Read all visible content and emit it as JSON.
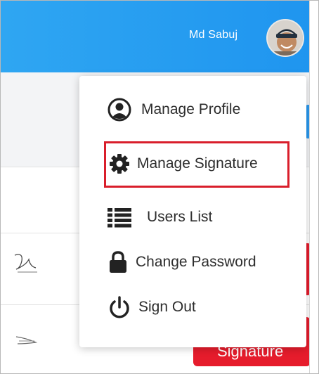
{
  "header": {
    "user_name": "Md Sabuj",
    "avatar_icon": "user-avatar-photo"
  },
  "menu": {
    "items": [
      {
        "label": "Manage Profile",
        "icon": "user-circle-icon"
      },
      {
        "label": "Manage Signature",
        "icon": "gear-icon",
        "highlighted": true
      },
      {
        "label": "Users List",
        "icon": "list-icon"
      },
      {
        "label": "Change Password",
        "icon": "lock-icon"
      },
      {
        "label": "Sign Out",
        "icon": "power-icon"
      }
    ]
  },
  "background": {
    "action_button_label": "Signature"
  },
  "colors": {
    "header": "#1f95ef",
    "accent_red": "#e61c2c",
    "highlight": "#d91e2b",
    "text": "#2d2d2d"
  }
}
